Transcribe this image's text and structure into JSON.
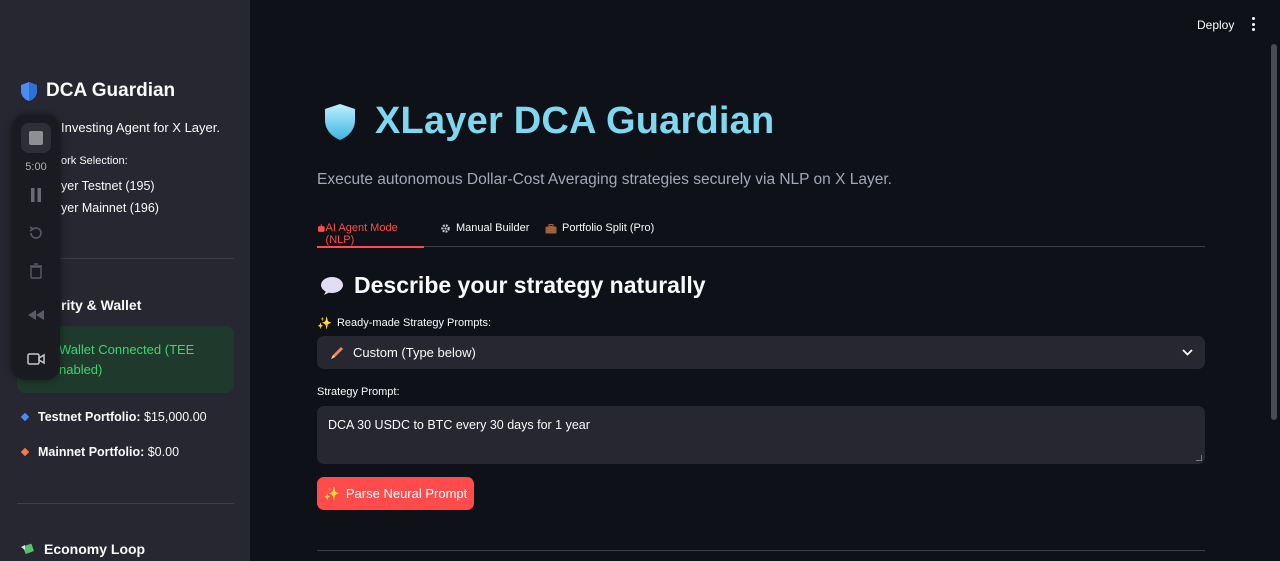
{
  "sidebar": {
    "title": "DCA Guardian",
    "description": "Investing Agent for X Layer.",
    "network_label": "ork Selection:",
    "networks": [
      {
        "label": "yer Testnet (195)",
        "selected": true
      },
      {
        "label": "yer Mainnet (196)",
        "selected": false
      }
    ],
    "security_heading": "rity & Wallet",
    "wallet_status_line1": "Wallet Connected (TEE",
    "wallet_status_line2": "nabled)",
    "testnet_label": "Testnet Portfolio:",
    "testnet_value": "$15,000.00",
    "mainnet_label": "Mainnet Portfolio:",
    "mainnet_value": "$0.00",
    "economy_heading": "Economy Loop"
  },
  "recorder": {
    "time": "5:00"
  },
  "header": {
    "deploy_label": "Deploy"
  },
  "main": {
    "title": "XLayer DCA Guardian",
    "subtitle": "Execute autonomous Dollar-Cost Averaging strategies securely via NLP on X Layer.",
    "tabs": [
      {
        "label": "AI Agent Mode (NLP)",
        "icon": "robot-icon",
        "active": true
      },
      {
        "label": "Manual Builder",
        "icon": "gear-icon",
        "active": false
      },
      {
        "label": "Portfolio Split (Pro)",
        "icon": "briefcase-icon",
        "active": false
      }
    ],
    "section_heading": "Describe your strategy naturally",
    "prompts_label": "Ready-made Strategy Prompts:",
    "prompts_selected": "Custom (Type below)",
    "strategy_label": "Strategy Prompt:",
    "strategy_value": "DCA 30 USDC to BTC every 30 days for 1 year",
    "parse_button": "Parse Neural Prompt"
  },
  "colors": {
    "accent": "#ff4b4b",
    "title": "#7dd8f0",
    "success": "#3dd56d",
    "background": "#0e1117",
    "sidebar": "#262730"
  }
}
